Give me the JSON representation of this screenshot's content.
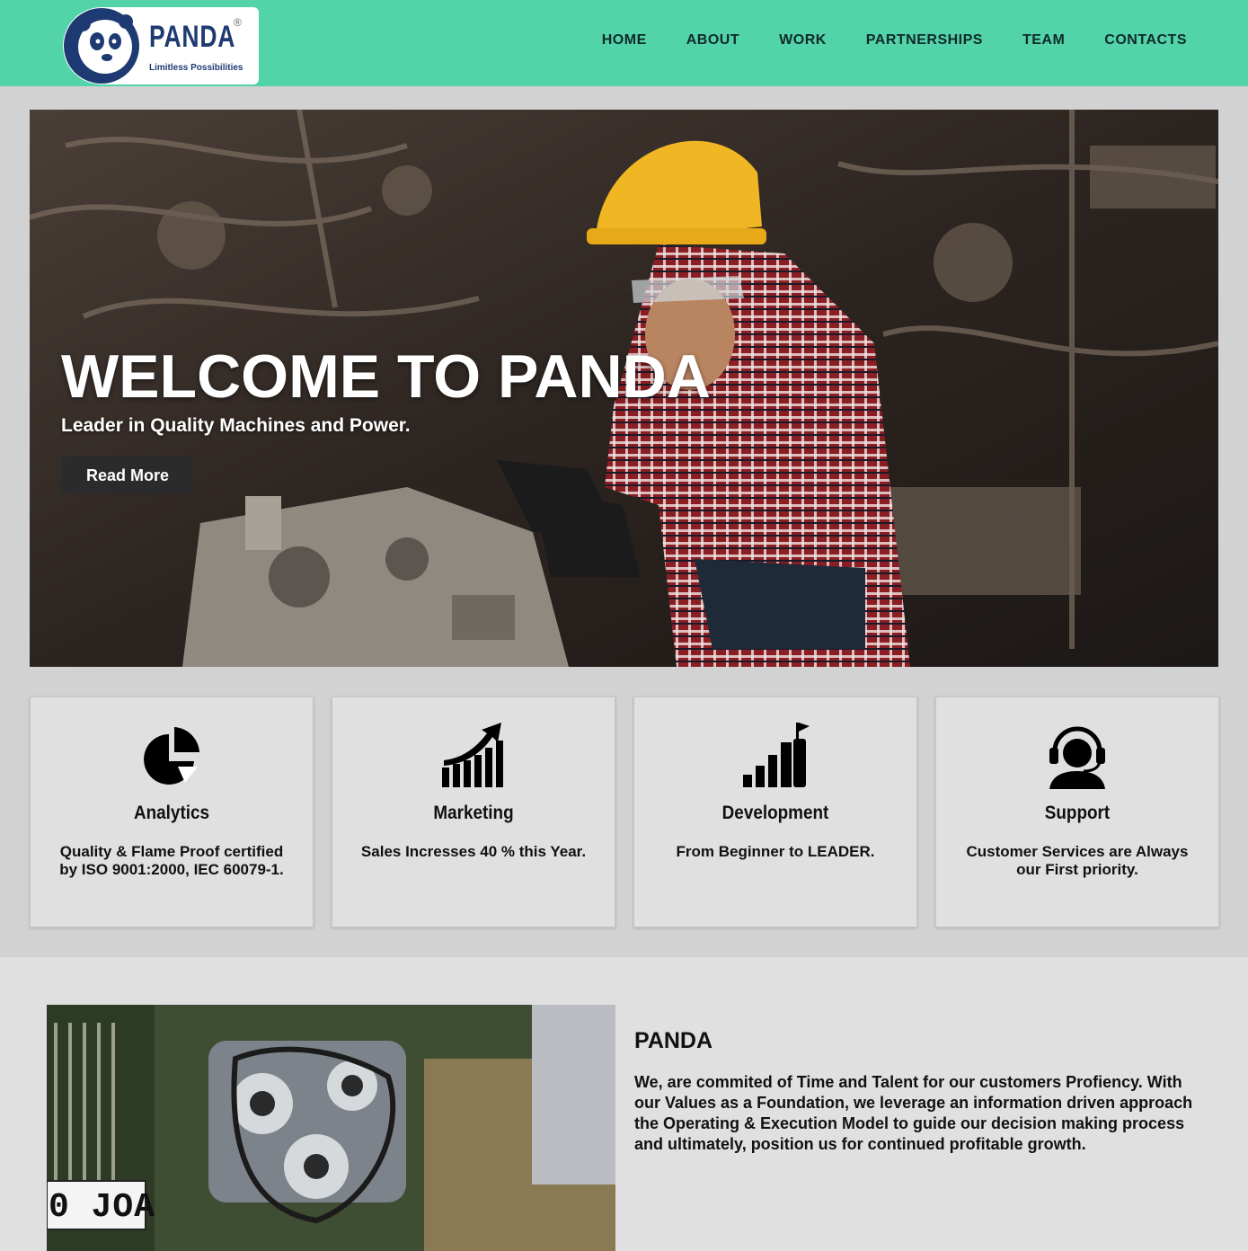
{
  "brand": {
    "name": "PANDA",
    "registered_mark": "®",
    "tagline": "Limitless Possibilities"
  },
  "nav": [
    "HOME",
    "ABOUT",
    "WORK",
    "PARTNERSHIPS",
    "TEAM",
    "CONTACTS"
  ],
  "hero": {
    "title": "WELCOME TO PANDA",
    "subtitle": "Leader in Quality Machines and Power.",
    "button_label": "Read More"
  },
  "features": [
    {
      "icon": "pie-chart-icon",
      "title": "Analytics",
      "text": "Quality & Flame Proof certified by ISO 9001:2000, IEC 60079-1."
    },
    {
      "icon": "growth-chart-icon",
      "title": "Marketing",
      "text": "Sales Incresses 40 % this Year."
    },
    {
      "icon": "rising-bars-flag-icon",
      "title": "Development",
      "text": "From Beginner to LEADER."
    },
    {
      "icon": "headset-support-icon",
      "title": "Support",
      "text": "Customer Services are Always our First priority."
    }
  ],
  "about": {
    "title": "PANDA",
    "text": "We, are commited of Time and Talent for our customers Profiency. With our Values as a Foundation, we leverage an information driven approach the Operating & Execution Model to guide our decision making process and ultimately, position us for continued profitable growth.",
    "plate_text": "0 JOA"
  },
  "colors": {
    "header_bg": "#52d3a8",
    "page_bg": "#d2d2d2",
    "card_bg": "#e0e0e0",
    "brand_navy": "#1e3a72",
    "button_bg": "#2b2b2b"
  }
}
